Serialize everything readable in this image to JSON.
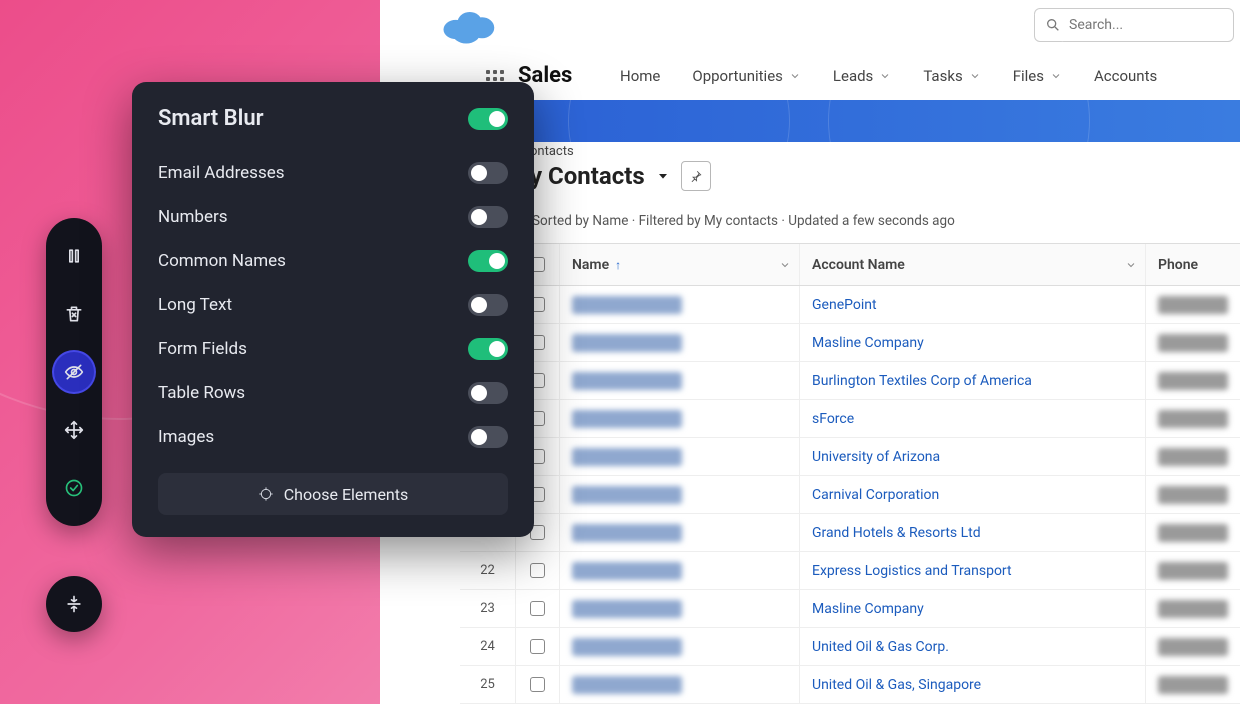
{
  "header": {
    "search_placeholder": "Search...",
    "app_name": "Sales",
    "nav": [
      "Home",
      "Opportunities",
      "Leads",
      "Tasks",
      "Files",
      "Accounts"
    ]
  },
  "list": {
    "object_label": "ontacts",
    "view_name": "y Contacts",
    "meta": "Sorted by Name · Filtered by My contacts · Updated a few seconds ago",
    "columns": {
      "name": "Name",
      "account": "Account Name",
      "phone": "Phone"
    }
  },
  "rows": [
    {
      "n": "",
      "acc": "GenePoint"
    },
    {
      "n": "",
      "acc": "Masline Company"
    },
    {
      "n": "",
      "acc": "Burlington Textiles Corp of America"
    },
    {
      "n": "",
      "acc": "sForce"
    },
    {
      "n": "",
      "acc": "University of Arizona"
    },
    {
      "n": "",
      "acc": "Carnival Corporation"
    },
    {
      "n": "",
      "acc": "Grand Hotels & Resorts Ltd"
    },
    {
      "n": "22",
      "acc": "Express Logistics and Transport"
    },
    {
      "n": "23",
      "acc": "Masline Company"
    },
    {
      "n": "24",
      "acc": "United Oil & Gas Corp."
    },
    {
      "n": "25",
      "acc": "United Oil & Gas, Singapore"
    }
  ],
  "panel": {
    "title": "Smart Blur",
    "master_on": true,
    "options": [
      {
        "label": "Email Addresses",
        "on": false
      },
      {
        "label": "Numbers",
        "on": false
      },
      {
        "label": "Common Names",
        "on": true
      },
      {
        "label": "Long Text",
        "on": false
      },
      {
        "label": "Form Fields",
        "on": true
      },
      {
        "label": "Table Rows",
        "on": false
      },
      {
        "label": "Images",
        "on": false
      }
    ],
    "choose_label": "Choose Elements"
  }
}
